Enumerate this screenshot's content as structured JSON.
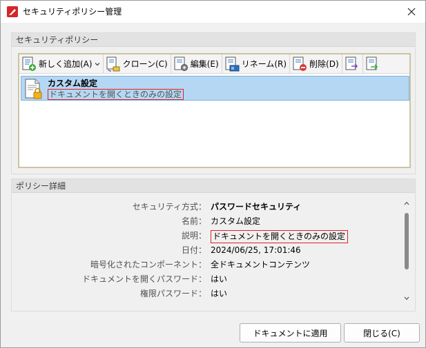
{
  "window": {
    "title": "セキュリティポリシー管理"
  },
  "policy_group": {
    "header": "セキュリティポリシー"
  },
  "toolbar": {
    "add_label": "新しく追加(A)",
    "clone_label": "クローン(C)",
    "edit_label": "編集(E)",
    "rename_label": "リネーム(R)",
    "delete_label": "削除(D)"
  },
  "policies": [
    {
      "name": "カスタム設定",
      "description": "ドキュメントを開くときのみの設定"
    }
  ],
  "details_group": {
    "header": "ポリシー詳細",
    "rows": [
      {
        "label": "セキュリティ方式",
        "value": "パスワードセキュリティ"
      },
      {
        "label": "名前",
        "value": "カスタム設定"
      },
      {
        "label": "説明",
        "value": "ドキュメントを開くときのみの設定"
      },
      {
        "label": "日付",
        "value": "2024/06/25, 17:01:46"
      },
      {
        "label": "暗号化されたコンポーネント",
        "value": "全ドキュメントコンテンツ"
      },
      {
        "label": "ドキュメントを開くパスワード",
        "value": "はい"
      },
      {
        "label": "権限パスワード",
        "value": "はい"
      }
    ],
    "colon": "："
  },
  "footer": {
    "apply_label": "ドキュメントに適用",
    "close_label": "閉じる(C)"
  },
  "colors": {
    "selection": "#b5d7f3",
    "highlight_box": "#e02020",
    "panel_border": "#ccc4a0"
  }
}
